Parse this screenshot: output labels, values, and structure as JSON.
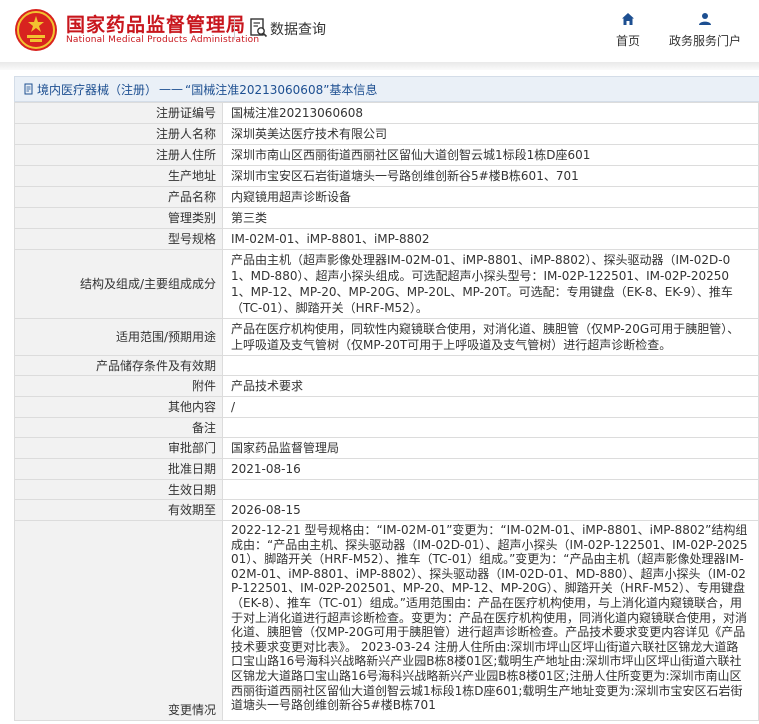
{
  "header": {
    "brand_cn": "国家药品监督管理局",
    "brand_en": "National Medical Products Administration",
    "search_label": "数据查询",
    "nav_home": "首页",
    "nav_portal": "政务服务门户",
    "brand_color": "#c8161d",
    "nav_icon_color": "#1d4f91"
  },
  "breadcrumb": {
    "category": "境内医疗器械（注册）",
    "separator": "——",
    "title": "“国械注准20213060608”基本信息"
  },
  "fields": [
    {
      "label": "注册证编号",
      "value": "国械注准20213060608"
    },
    {
      "label": "注册人名称",
      "value": "深圳英美达医疗技术有限公司"
    },
    {
      "label": "注册人住所",
      "value": "深圳市南山区西丽街道西丽社区留仙大道创智云城1标段1栋D座601"
    },
    {
      "label": "生产地址",
      "value": "深圳市宝安区石岩街道塘头一号路创维创新谷5#楼B栋601、701"
    },
    {
      "label": "产品名称",
      "value": "内窥镜用超声诊断设备"
    },
    {
      "label": "管理类别",
      "value": "第三类"
    },
    {
      "label": "型号规格",
      "value": "IM-02M-01、iMP-8801、iMP-8802"
    },
    {
      "label": "结构及组成/主要组成成分",
      "value": "产品由主机（超声影像处理器IM-02M-01、iMP-8801、iMP-8802）、探头驱动器（IM-02D-01、MD-880）、超声小探头组成。可选配超声小探头型号：IM-02P-122501、IM-02P-202501、MP-12、MP-20、MP-20G、MP-20L、MP-20T。可选配：专用键盘（EK-8、EK-9）、推车（TC-01）、脚踏开关（HRF-M52）。"
    },
    {
      "label": "适用范围/预期用途",
      "value": "产品在医疗机构使用，同软性内窥镜联合使用，对消化道、胰胆管（仅MP-20G可用于胰胆管）、上呼吸道及支气管树（仅MP-20T可用于上呼吸道及支气管树）进行超声诊断检查。"
    },
    {
      "label": "产品储存条件及有效期",
      "value": ""
    },
    {
      "label": "附件",
      "value": "产品技术要求"
    },
    {
      "label": "其他内容",
      "value": "/"
    },
    {
      "label": "备注",
      "value": ""
    },
    {
      "label": "审批部门",
      "value": "国家药品监督管理局"
    },
    {
      "label": "批准日期",
      "value": "2021-08-16"
    },
    {
      "label": "生效日期",
      "value": ""
    },
    {
      "label": "有效期至",
      "value": "2026-08-15"
    },
    {
      "label": "变更情况",
      "value": "2022-12-21 型号规格由：“IM-02M-01”变更为：“IM-02M-01、iMP-8801、iMP-8802”结构组成由：“产品由主机、探头驱动器（IM-02D-01）、超声小探头（IM-02P-122501、IM-02P-202501）、脚踏开关（HRF-M52）、推车（TC-01）组成。”变更为：“产品由主机（超声影像处理器IM-02M-01、iMP-8801、iMP-8802）、探头驱动器（IM-02D-01、MD-880）、超声小探头（IM-02P-122501、IM-02P-202501、MP-20、MP-12、MP-20G）、脚踏开关（HRF-M52）、专用键盘（EK-8）、推车（TC-01）组成。”适用范围由：产品在医疗机构使用，与上消化道内窥镜联合，用于对上消化道进行超声诊断检查。变更为：产品在医疗机构使用，同消化道内窥镜联合使用，对消化道、胰胆管（仅MP-20G可用于胰胆管）进行超声诊断检查。产品技术要求变更内容详见《产品技术要求变更对比表》。 2023-03-24 注册人住所由:深圳市坪山区坪山街道六联社区锦龙大道路口宝山路16号海科兴战略新兴产业园B栋8楼01区;载明生产地址由:深圳市坪山区坪山街道六联社区锦龙大道路口宝山路16号海科兴战略新兴产业园B栋8楼01区;注册人住所变更为:深圳市南山区西丽街道西丽社区留仙大道创智云城1标段1栋D座601;载明生产地址变更为:深圳市宝安区石岩街道塘头一号路创维创新谷5#楼B栋701"
    }
  ]
}
